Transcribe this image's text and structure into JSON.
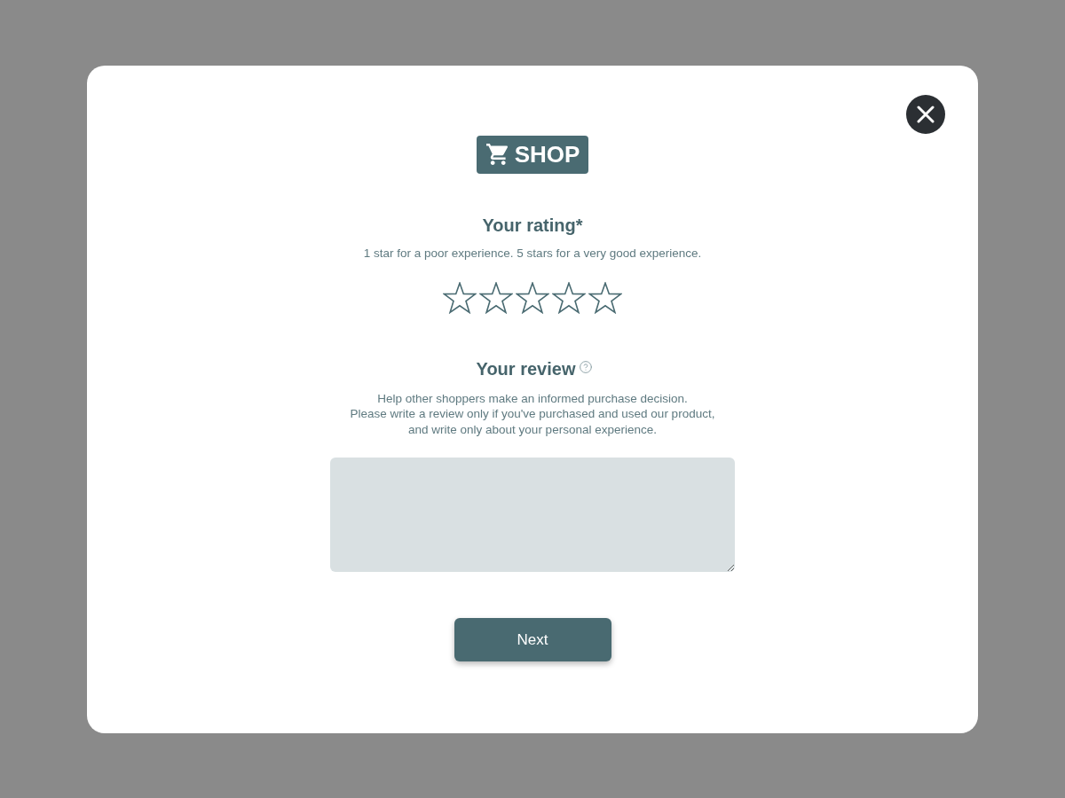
{
  "logo": {
    "text": "SHOP"
  },
  "rating": {
    "title": "Your rating*",
    "hint": "1 star for a poor experience. 5 stars for a very good experience.",
    "stars": 0
  },
  "review": {
    "title": "Your review",
    "description": "Help other shoppers make an informed purchase decision.\nPlease write a review only if you've purchased and used our product,\nand write only about your personal experience."
  },
  "next_button": {
    "label": "Next"
  }
}
